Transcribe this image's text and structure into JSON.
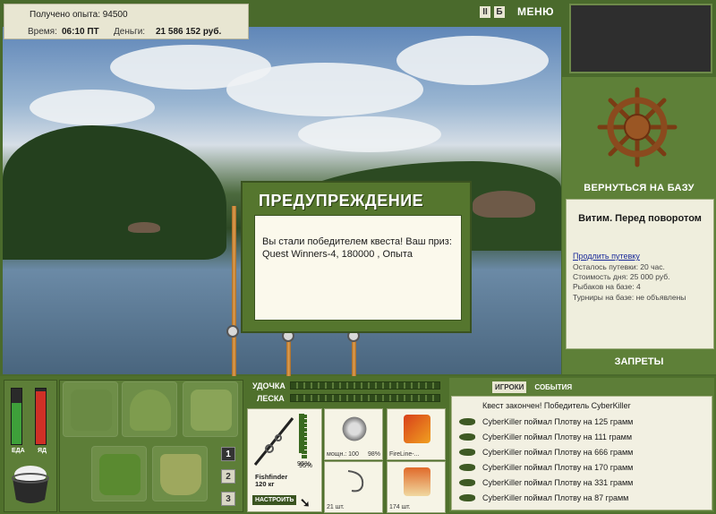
{
  "status": {
    "xp_text": "Получено опыта: 94500",
    "time_label": "Время:",
    "time_value": "06:10 ПТ",
    "money_label": "Деньги:",
    "money_value": "21 586 152 руб."
  },
  "toolbar": {
    "pause_label": "II",
    "sound_label": "Б",
    "menu_label": "МЕНЮ"
  },
  "location": {
    "return_label": "ВЕРНУТЬСЯ НА БАЗУ",
    "title": "Витим. Перед поворотом",
    "extend_link": "Продлить путевку",
    "lines": [
      "Осталось путевки: 20 час.",
      "Стоимость дня: 25 000 руб.",
      "Рыбаков на базе: 4",
      "Турниры на базе: не объявлены"
    ],
    "bans_label": "ЗАПРЕТЫ"
  },
  "modal": {
    "title": "ПРЕДУПРЕЖДЕНИЕ",
    "message": "Вы стали победителем квеста! Ваш приз: Quest Winners-4, 180000 , Опыта"
  },
  "gauges": {
    "food_label": "ЕДА",
    "health_label": "ЯД",
    "food_level": 0.75,
    "health_level": 0.95
  },
  "inventory": {
    "pages": [
      "1",
      "2",
      "3"
    ],
    "active_page": "1"
  },
  "tackle": {
    "rod_label": "УДОЧКА",
    "line_label": "ЛЕСКА",
    "rod_name": "Fishfinder",
    "rod_weight": "120 кг",
    "rod_percent": "95%",
    "setup_label": "НАСТРОИТЬ",
    "reel_caption": "мощн.: 100",
    "reel_percent": "98%",
    "line_caption": "FireLine-...",
    "hook_caption": "21 шт.",
    "bait_caption": "174 шт."
  },
  "events": {
    "tabs": [
      "ИГРОКИ",
      "СОБЫТИЯ"
    ],
    "header": "Квест закончен! Победитель CyberKiller",
    "rows": [
      "CyberKiller поймал Плотву на 125 грамм",
      "CyberKiller поймал Плотву на 111 грамм",
      "CyberKiller поймал Плотву на 666 грамм",
      "CyberKiller поймал Плотву на 170 грамм",
      "CyberKiller поймал Плотву на 331 грамм",
      "CyberKiller поймал Плотву на 87 грамм"
    ]
  }
}
